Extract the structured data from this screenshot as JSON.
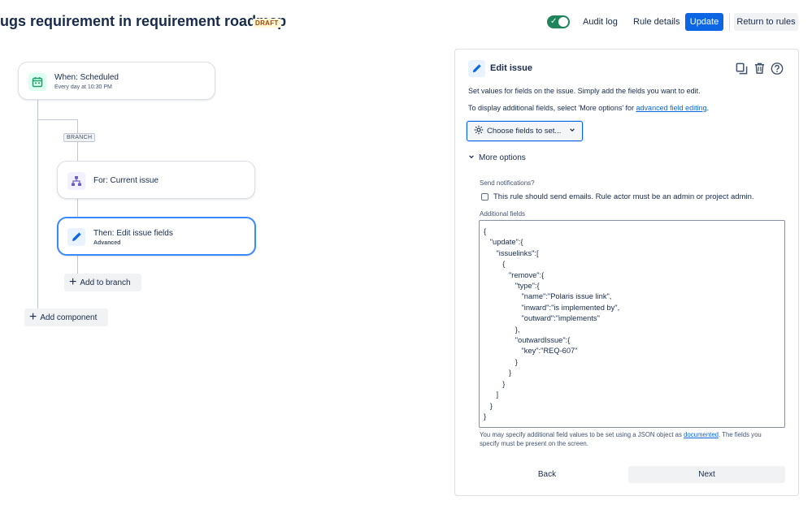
{
  "header": {
    "title": "ugs requirement in requirement roadmap",
    "badge": "DRAFT",
    "audit_log": "Audit log",
    "rule_details": "Rule details",
    "update": "Update",
    "return": "Return to rules",
    "toggle_on": true,
    "colors": {
      "primary": "#0c66e4",
      "toggle": "#1f845a",
      "badge_bg": "#fff7d6",
      "badge_text": "#a54800"
    }
  },
  "flow": {
    "trigger": {
      "title": "When: Scheduled",
      "subtitle": "Every day at 10:30 PM",
      "icon": "calendar-icon",
      "icon_color": "#22a06b"
    },
    "branch_label": "BRANCH",
    "branch_node": {
      "title": "For: Current issue",
      "icon": "hierarchy-icon",
      "icon_color": "#6e5dc6"
    },
    "action_node": {
      "title": "Then: Edit issue fields",
      "subtitle": "Advanced",
      "icon": "pencil-icon",
      "icon_color": "#0c66e4"
    },
    "add_to_branch": "Add to branch",
    "add_component": "Add component"
  },
  "panel": {
    "title": "Edit issue",
    "desc1": "Set values for fields on the issue. Simply add the fields you want to edit.",
    "desc2_prefix": "To display additional fields, select 'More options' for ",
    "desc2_link": "advanced field editing",
    "desc2_suffix": ".",
    "choose_fields": "Choose fields to set...",
    "more_options": "More options",
    "send_notifications_label": "Send notifications?",
    "send_notifications_text": "This rule should send emails. Rule actor must be an admin or project admin.",
    "additional_fields_label": "Additional fields",
    "json_lines": [
      "{",
      "   \"update\":{",
      "      \"issuelinks\":[",
      "         {",
      "            \"remove\":{",
      "               \"type\":{",
      "                  \"name\":\"Polaris issue link\",",
      "                  \"inward\":\"is implemented by\",",
      "                  \"outward\":\"implements\"",
      "               },",
      "               \"outwardIssue\":{",
      "                  \"key\":\"REQ-607\"",
      "               }",
      "            }",
      "         }",
      "      ]",
      "   }",
      "}"
    ],
    "help_prefix": "You may specify additional field values to be set using a JSON object as ",
    "help_link": "documented",
    "help_suffix": ". The fields you",
    "help_line2": "specify must be present on the screen.",
    "back": "Back",
    "next": "Next"
  }
}
